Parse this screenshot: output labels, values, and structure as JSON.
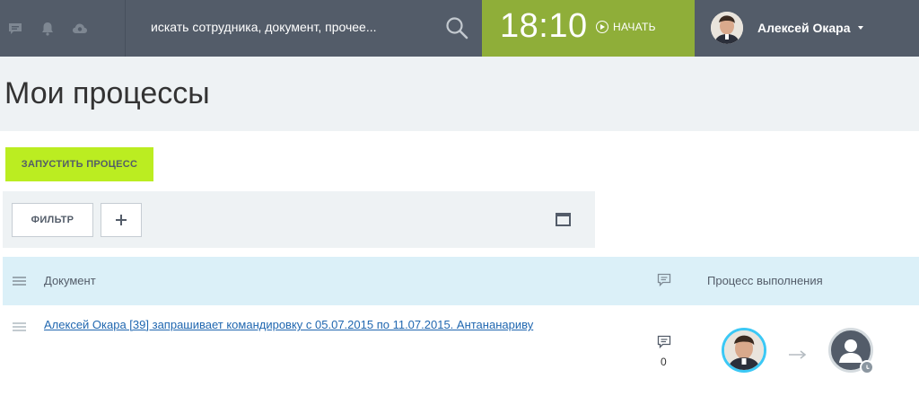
{
  "header": {
    "search_placeholder": "искать сотрудника, документ, прочее...",
    "clock_time": "18:10",
    "start_label": "НАЧАТЬ",
    "user_name": "Алексей Окара",
    "icons": [
      "chat-icon",
      "bell-icon",
      "cloud-icon",
      "search-icon"
    ]
  },
  "page": {
    "title": "Мои процессы",
    "start_process_label": "ЗАПУСТИТЬ ПРОЦЕСС"
  },
  "filter": {
    "filter_label": "ФИЛЬТР",
    "add_label": "+"
  },
  "table": {
    "columns": [
      "Документ",
      "Процесс выполнения"
    ],
    "rows": [
      {
        "document": "Алексей Окара [39] запрашивает командировку с 05.07.2015 по 11.07.2015. Антананариву",
        "comments": "0"
      }
    ]
  },
  "colors": {
    "topbar": "#535c69",
    "clock": "#8fae39",
    "accent_button": "#bbed21",
    "header_row": "#dbf0f8",
    "link": "#2067b0",
    "avatar_ring": "#3bc8f5"
  }
}
